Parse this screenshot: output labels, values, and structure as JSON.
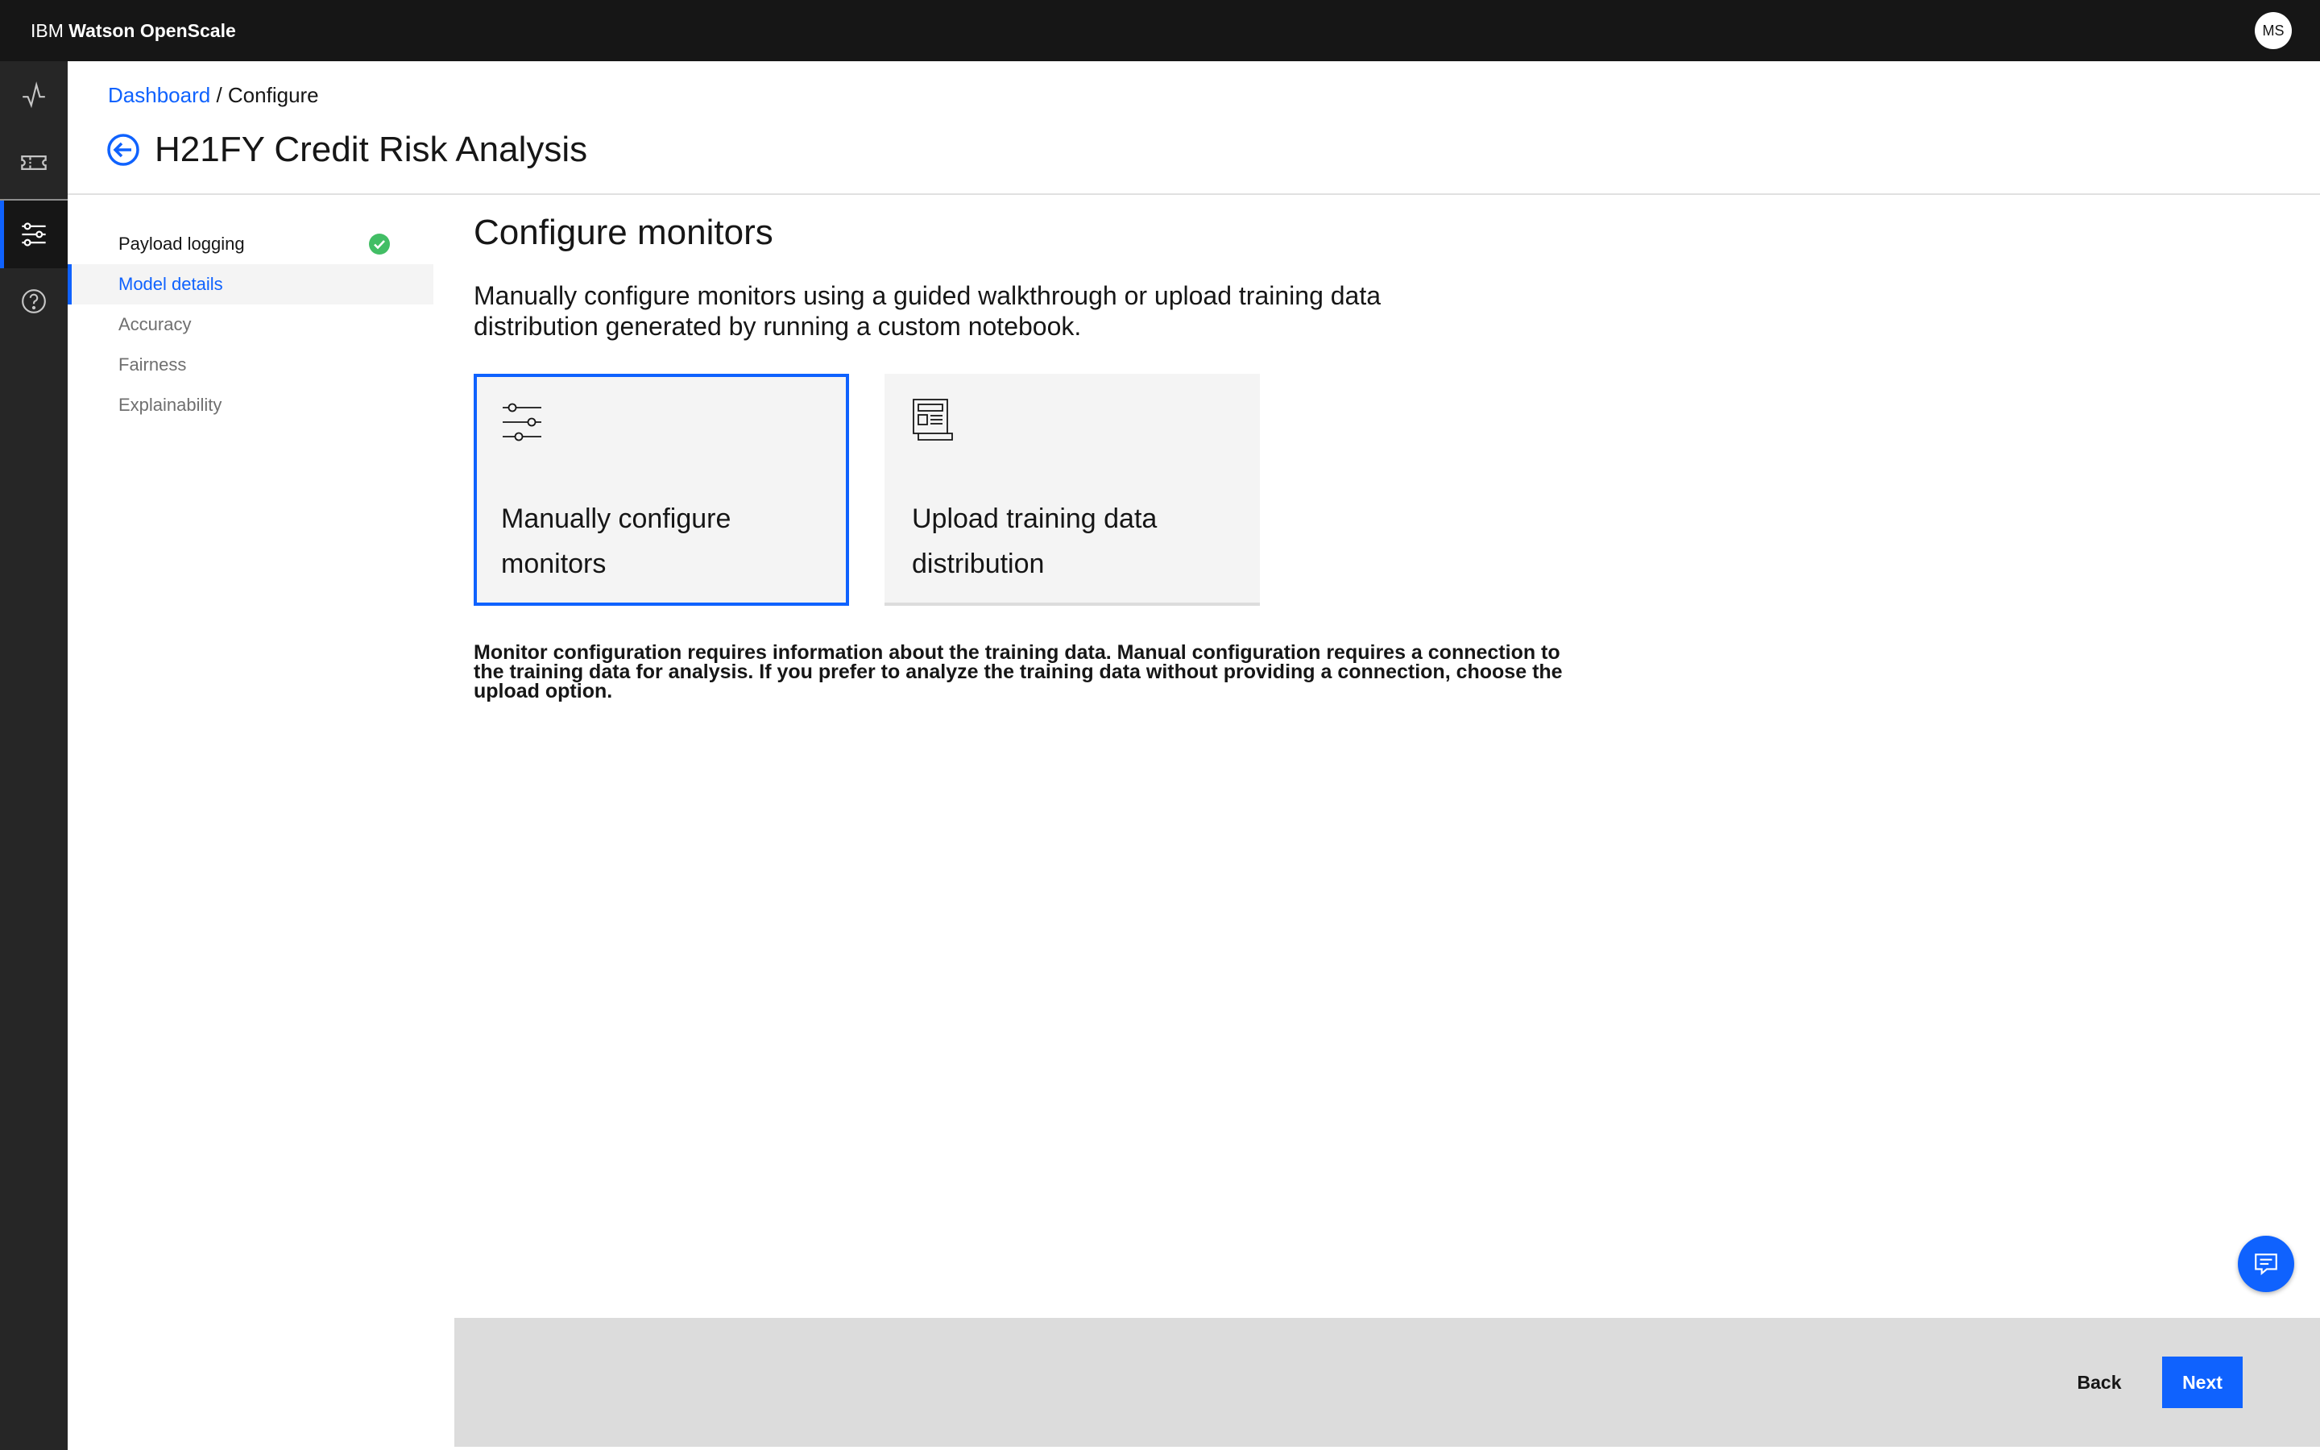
{
  "header": {
    "brand_prefix": "IBM",
    "brand_name": "Watson OpenScale",
    "avatar_initials": "MS"
  },
  "rail": {
    "items": [
      {
        "icon": "activity-icon"
      },
      {
        "icon": "ticket-icon"
      },
      {
        "icon": "settings-adjust-icon",
        "active": true
      },
      {
        "icon": "help-icon"
      }
    ]
  },
  "breadcrumb": {
    "parent": "Dashboard",
    "separator": "/",
    "current": "Configure"
  },
  "page": {
    "title": "H21FY Credit Risk Analysis"
  },
  "steps": [
    {
      "label": "Payload logging",
      "status": "complete"
    },
    {
      "label": "Model details",
      "status": "current"
    },
    {
      "label": "Accuracy",
      "status": "pending"
    },
    {
      "label": "Fairness",
      "status": "pending"
    },
    {
      "label": "Explainability",
      "status": "pending"
    }
  ],
  "main": {
    "title": "Configure monitors",
    "description": "Manually configure monitors using a guided walkthrough or upload training data distribution generated by running a custom notebook.",
    "cards": [
      {
        "label": "Manually configure monitors",
        "icon": "sliders-icon",
        "selected": true
      },
      {
        "label": "Upload training data distribution",
        "icon": "document-upload-icon",
        "selected": false
      }
    ],
    "note": "Monitor configuration requires information about the training data. Manual configuration requires a connection to the training data for analysis. If you prefer to analyze the training data without providing a connection, choose the upload option."
  },
  "footer": {
    "back_label": "Back",
    "next_label": "Next"
  },
  "colors": {
    "accent": "#0f62fe",
    "header_bg": "#161616",
    "rail_bg": "#262626",
    "success": "#42be65"
  }
}
